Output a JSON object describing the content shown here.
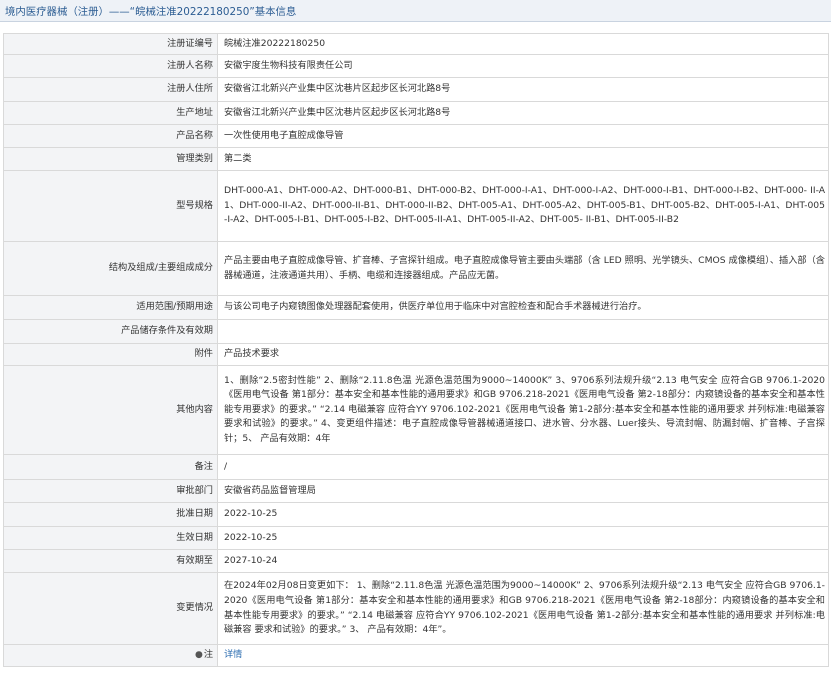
{
  "header": {
    "title": "境内医疗器械（注册）——“皖械注准20222180250”基本信息",
    "title_icon": "document-icon"
  },
  "fields": {
    "reg_no": {
      "label": "注册证编号",
      "value": "皖械注准20222180250"
    },
    "registrant": {
      "label": "注册人名称",
      "value": "安徽宇度生物科技有限责任公司"
    },
    "registrant_address": {
      "label": "注册人住所",
      "value": "安徽省江北新兴产业集中区沈巷片区起步区长河北路8号"
    },
    "production_address": {
      "label": "生产地址",
      "value": "安徽省江北新兴产业集中区沈巷片区起步区长河北路8号"
    },
    "product_name": {
      "label": "产品名称",
      "value": "一次性使用电子直腔成像导管"
    },
    "category": {
      "label": "管理类别",
      "value": "第二类"
    },
    "models": {
      "label": "型号规格",
      "value": "DHT-000-A1、DHT-000-A2、DHT-000-B1、DHT-000-B2、DHT-000-I-A1、DHT-000-I-A2、DHT-000-I-B1、DHT-000-I-B2、DHT-000- II-A1、DHT-000-II-A2、DHT-000-II-B1、DHT-000-II-B2、DHT-005-A1、DHT-005-A2、DHT-005-B1、DHT-005-B2、DHT-005-I-A1、DHT-005-I-A2、DHT-005-I-B1、DHT-005-I-B2、DHT-005-II-A1、DHT-005-II-A2、DHT-005- II-B1、DHT-005-II-B2"
    },
    "structure": {
      "label": "结构及组成/主要组成成分",
      "value": "产品主要由电子直腔成像导管、扩音棒、子宫探针组成。电子直腔成像导管主要由头端部（含 LED 照明、光学镜头、CMOS 成像模组）、插入部（含器械通道，注液通道共用）、手柄、电缆和连接器组成。产品应无菌。"
    },
    "scope": {
      "label": "适用范围/预期用途",
      "value": "与该公司电子内窥镜图像处理器配套使用，供医疗单位用于临床中对宫腔检查和配合手术器械进行治疗。"
    },
    "storage": {
      "label": "产品储存条件及有效期",
      "value": ""
    },
    "attachment": {
      "label": "附件",
      "value": "产品技术要求"
    },
    "other": {
      "label": "其他内容",
      "value": "1、删除“2.5密封性能” 2、删除“2.11.8色温 光源色温范围为9000~14000K” 3、9706系列法规升级“2.13 电气安全 应符合GB 9706.1-2020《医用电气设备 第1部分：基本安全和基本性能的通用要求》和GB 9706.218-2021《医用电气设备 第2-18部分：内窥镜设备的基本安全和基本性能专用要求》的要求。” “2.14 电磁兼容 应符合YY 9706.102-2021《医用电气设备 第1-2部分:基本安全和基本性能的通用要求 并列标准:电磁兼容 要求和试验》的要求。” 4、变更组件描述：电子直腔成像导管器械通道接口、进水管、分水器、Luer接头、导流封帽、防漏封帽、扩音棒、子宫探针；5、 产品有效期：4年"
    },
    "remark": {
      "label": "备注",
      "value": "/"
    },
    "authority": {
      "label": "审批部门",
      "value": "安徽省药品监督管理局"
    },
    "approval_date": {
      "label": "批准日期",
      "value": "2022-10-25"
    },
    "effective_date": {
      "label": "生效日期",
      "value": "2022-10-25"
    },
    "expiry_date": {
      "label": "有效期至",
      "value": "2027-10-24"
    },
    "changes": {
      "label": "变更情况",
      "value": "在2024年02月08日变更如下： 1、删除“2.11.8色温 光源色温范围为9000~14000K” 2、9706系列法规升级“2.13 电气安全 应符合GB 9706.1-2020《医用电气设备 第1部分：基本安全和基本性能的通用要求》和GB 9706.218-2021《医用电气设备 第2-18部分：内窥镜设备的基本安全和基本性能专用要求》的要求。” “2.14 电磁兼容 应符合YY 9706.102-2021《医用电气设备 第1-2部分:基本安全和基本性能的通用要求 并列标准:电磁兼容 要求和试验》的要求。” 3、 产品有效期：4年”。"
    },
    "note": {
      "label": "注",
      "icon": "pin-icon",
      "link_text": "详情"
    }
  },
  "colors": {
    "header_bg": "#eef2f7",
    "header_text": "#2c5d93",
    "label_bg": "#f3f4f6",
    "border": "#d9d9d9",
    "link": "#2b6cb0"
  }
}
